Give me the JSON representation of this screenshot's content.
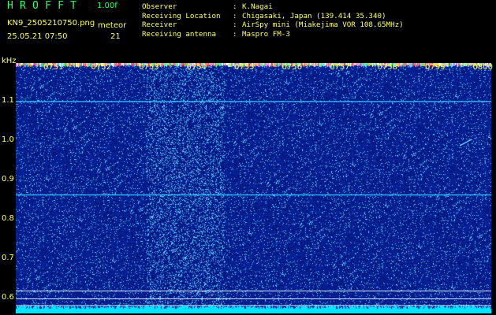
{
  "header": {
    "app_title": "HROFFT",
    "version": "1.00f",
    "filename": "KN9_2505210750.png",
    "meteor_label": "meteor",
    "timestamp": "25.05.21 07:50",
    "meteor_count": "21"
  },
  "metadata": [
    {
      "key": "Observer",
      "sep": ":",
      "value": "K.Nagai"
    },
    {
      "key": "Receiving Location",
      "sep": ":",
      "value": "Chigasaki, Japan (139.414 35.340)"
    },
    {
      "key": "Receiver",
      "sep": ":",
      "value": "AirSpy mini (Miakejima VOR 108.65MHz)"
    },
    {
      "key": "Receiving antenna",
      "sep": ":",
      "value": "Maspro FM-3"
    }
  ],
  "axis": {
    "y_unit": "kHz",
    "y_ticks": [
      {
        "label": "1.1",
        "value": 1.1
      },
      {
        "label": "1.0",
        "value": 1.0
      },
      {
        "label": "0.9",
        "value": 0.9
      },
      {
        "label": "0.8",
        "value": 0.8
      },
      {
        "label": "0.7",
        "value": 0.7
      },
      {
        "label": "0.6",
        "value": 0.6
      }
    ],
    "x_ticks": [
      {
        "label": "0751",
        "minute": 1
      },
      {
        "label": "0752",
        "minute": 2
      },
      {
        "label": "0753",
        "minute": 3
      },
      {
        "label": "0754",
        "minute": 4
      },
      {
        "label": "0755",
        "minute": 5
      },
      {
        "label": "0756",
        "minute": 6
      },
      {
        "label": "0757",
        "minute": 7
      },
      {
        "label": "0758",
        "minute": 8
      },
      {
        "label": "0799",
        "minute": 9
      },
      {
        "label": "0800",
        "minute": 10
      }
    ]
  },
  "colors": {
    "background": "#000000",
    "noise_floor": "#0a1a8c",
    "header_green": "#33ff66",
    "label_yellow": "#ffff66",
    "carrier_line": "#33ccff",
    "bottom_band": "#00e5ff"
  },
  "signals": {
    "horizontal_carriers_khz": [
      1.1,
      0.863
    ],
    "reference_lines_khz": [
      0.619,
      0.599,
      0.582
    ]
  }
}
